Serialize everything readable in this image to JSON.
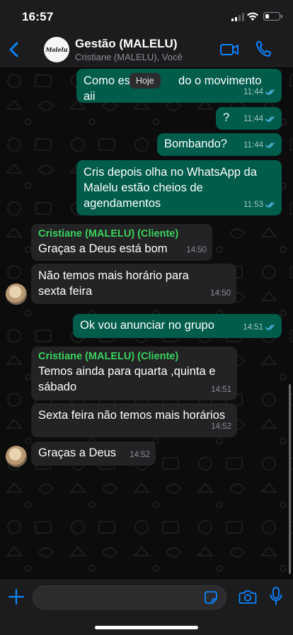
{
  "status_bar": {
    "time": "16:57",
    "battery_level": 0.25
  },
  "header": {
    "title": "Gestão (MALELU)",
    "subtitle": "Cristiane (MALELU), Você",
    "avatar_logo_text": "Malelu"
  },
  "chat": {
    "date_label": "Hoje",
    "messages": [
      {
        "direction": "out",
        "text": "Como esta indo o movimento aii",
        "visible_text_left": "Como es",
        "visible_text_right": "do o movimento aii",
        "time": "11:44",
        "status": "read"
      },
      {
        "direction": "out",
        "text": "?",
        "time": "11:44",
        "status": "read"
      },
      {
        "direction": "out",
        "text": "Bombando?",
        "time": "11:44",
        "status": "read"
      },
      {
        "direction": "out",
        "text": "Cris depois olha no WhatsApp da Malelu estão cheios de agendamentos",
        "time": "11:53",
        "status": "read"
      },
      {
        "direction": "in",
        "sender": "Cristiane (MALELU) (Cliente)",
        "text": "Graças a Deus está bom",
        "time": "14:50"
      },
      {
        "direction": "in",
        "text": "Não temos mais horário para sexta feira",
        "time": "14:50"
      },
      {
        "direction": "out",
        "text": "Ok vou anunciar no grupo",
        "time": "14:51",
        "status": "read"
      },
      {
        "direction": "in",
        "sender": "Cristiane (MALELU) (Cliente)",
        "text": "Temos ainda para quarta ,quinta e sábado",
        "time": "14:51"
      },
      {
        "direction": "in",
        "text": "Sexta feira não temos mais horários",
        "time": "14:52"
      },
      {
        "direction": "in",
        "text": "Graças a Deus",
        "time": "14:52"
      }
    ]
  },
  "input": {
    "value": "",
    "placeholder": ""
  },
  "colors": {
    "accent": "#0a84ff",
    "outgoing_bubble": "#005c4b",
    "incoming_bubble": "#232326",
    "sender_name": "#3ad25c",
    "read_ticks": "#53bdeb"
  },
  "icons": [
    "back-chevron-icon",
    "video-call-icon",
    "phone-icon",
    "plus-icon",
    "sticker-icon",
    "camera-icon",
    "microphone-icon",
    "double-check-icon"
  ]
}
